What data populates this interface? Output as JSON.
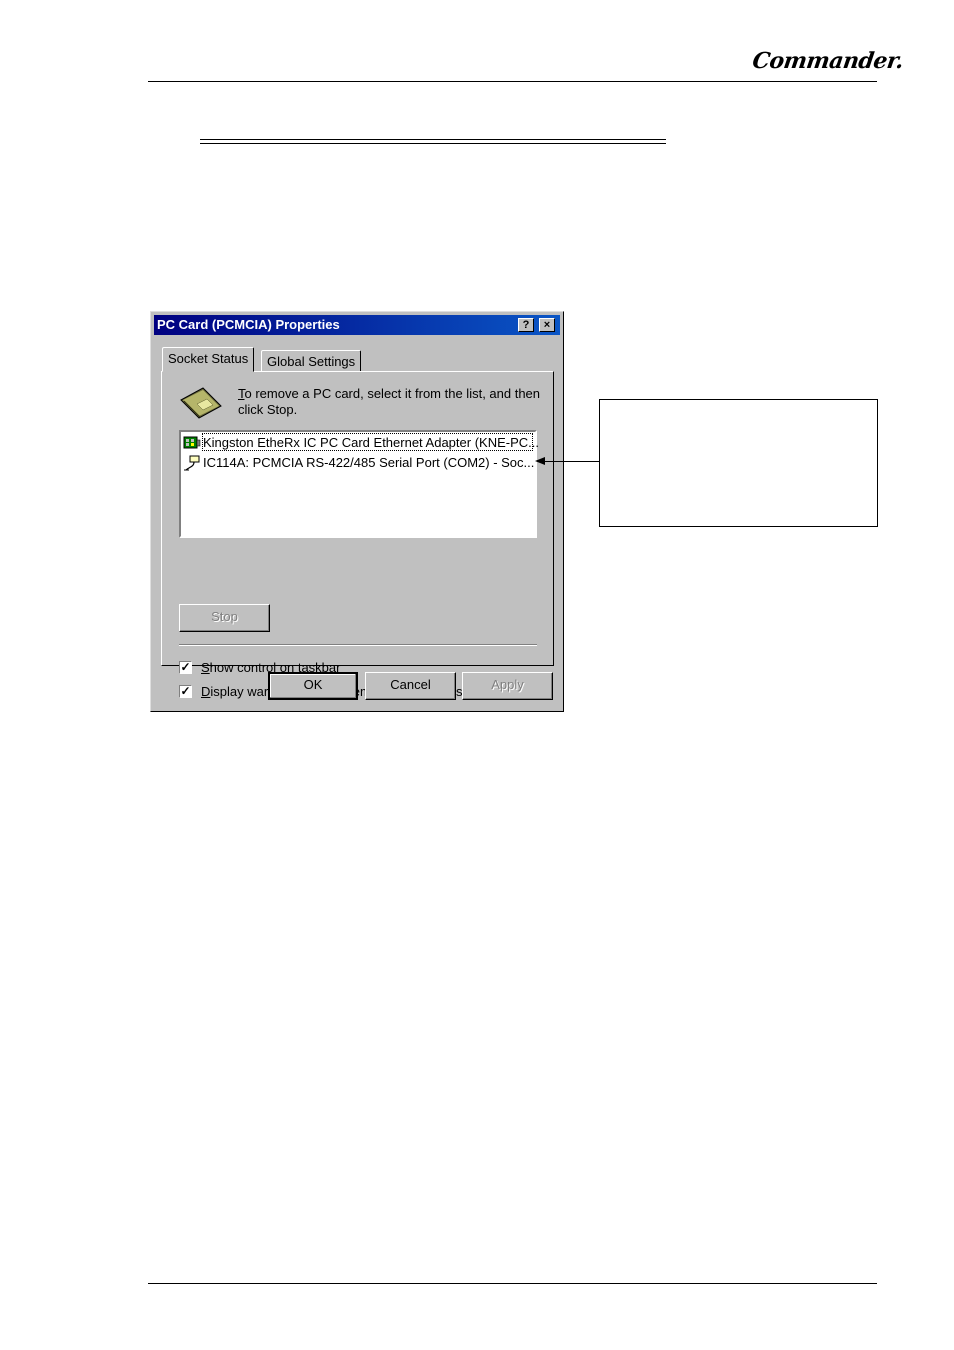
{
  "header": {
    "logo": "Commander."
  },
  "dialog": {
    "title": "PC Card (PCMCIA) Properties",
    "help_button": "?",
    "close_button": "×",
    "tabs": [
      {
        "label": "Socket Status",
        "active": true
      },
      {
        "label": "Global Settings",
        "active": false
      }
    ],
    "instruction_line1_accel": "T",
    "instruction_line1_rest": "o remove a PC card, select it from the list, and then",
    "instruction_line2": "click Stop.",
    "devices": [
      {
        "label": "Kingston EtheRx IC PC Card Ethernet Adapter (KNE-PC...",
        "icon": "network-adapter-icon",
        "selected": true
      },
      {
        "label": "IC114A: PCMCIA RS-422/485 Serial Port (COM2) - Soc...",
        "icon": "serial-port-icon",
        "selected": false
      }
    ],
    "stop_button": "Stop",
    "show_control_accel": "S",
    "show_control_rest": "how control on taskbar",
    "show_control_checked": true,
    "display_warning_accel": "D",
    "display_warning_rest": "isplay warning if card is removed before it is stopped",
    "display_warning_checked": true,
    "ok_button": "OK",
    "cancel_button": "Cancel",
    "apply_button": "Apply"
  }
}
